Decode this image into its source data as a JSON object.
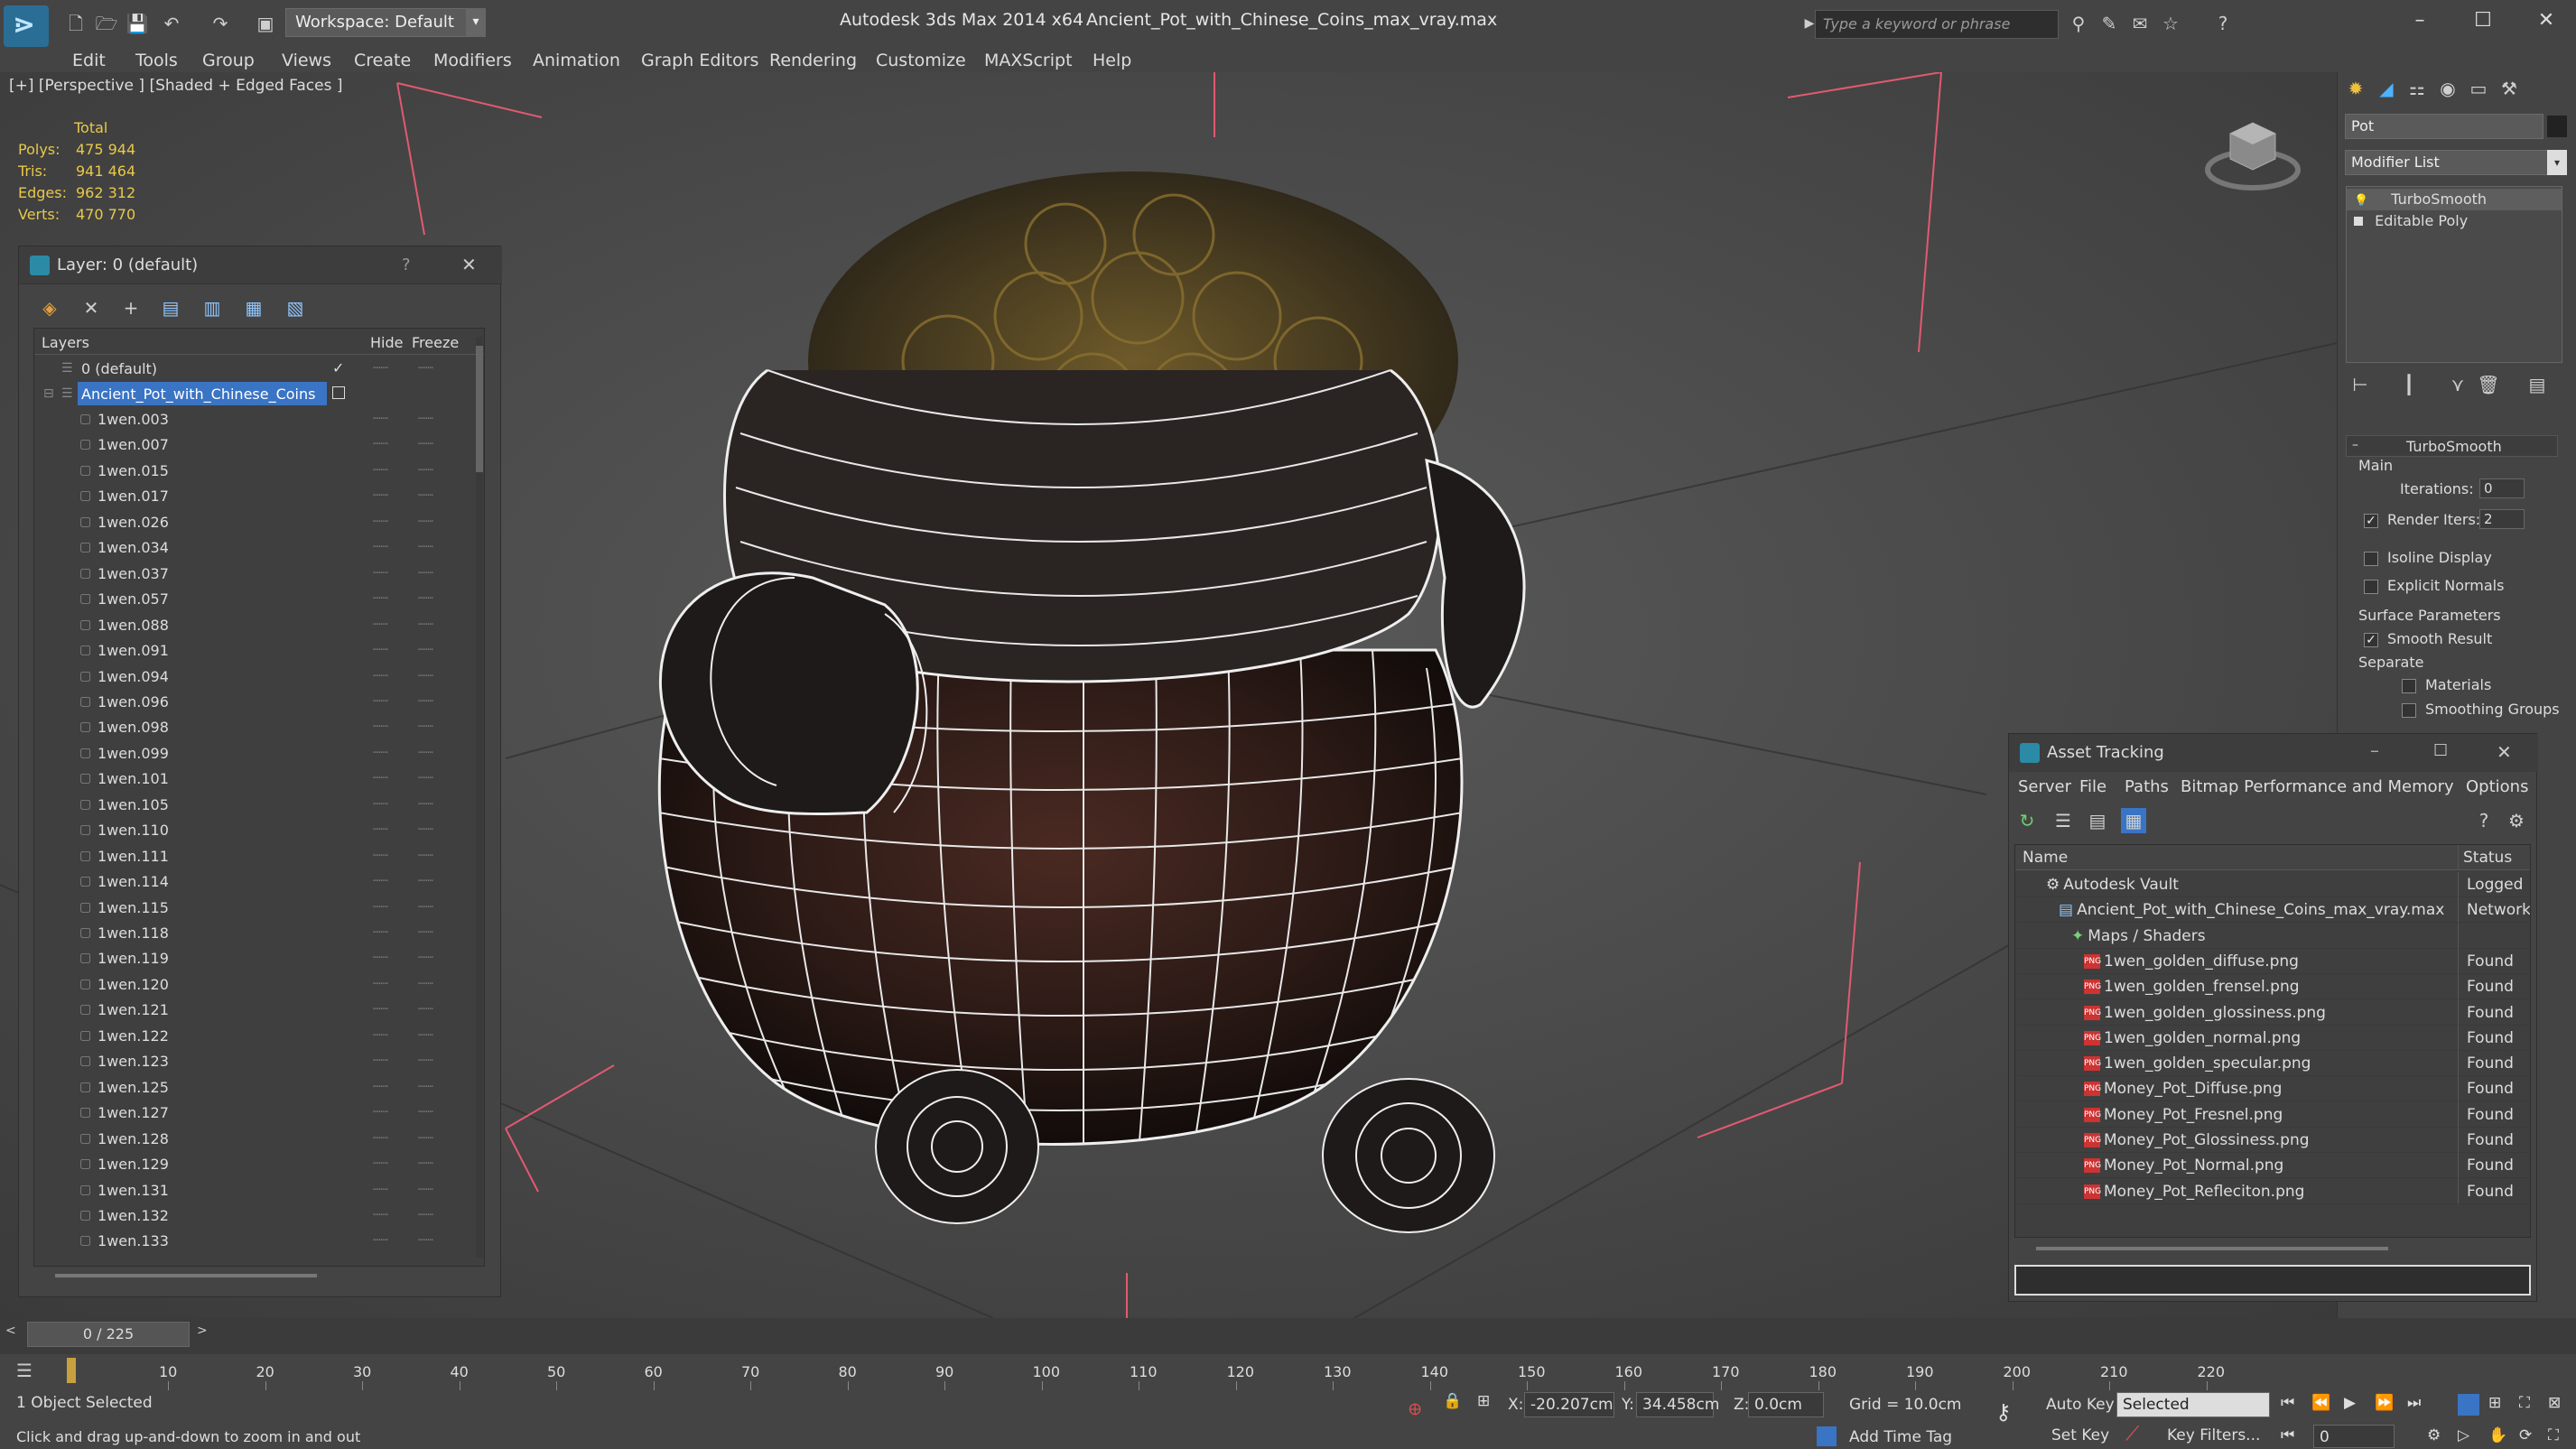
{
  "titlebar": {
    "app_title": "Autodesk 3ds Max  2014 x64",
    "file_title": "Ancient_Pot_with_Chinese_Coins_max_vray.max",
    "workspace": "Workspace: Default",
    "search_placeholder": "Type a keyword or phrase"
  },
  "menubar": {
    "items": [
      "Edit",
      "Tools",
      "Group",
      "Views",
      "Create",
      "Modifiers",
      "Animation",
      "Graph Editors",
      "Rendering",
      "Customize",
      "MAXScript",
      "Help"
    ]
  },
  "viewport": {
    "label": "[+] [Perspective ] [Shaded + Edged Faces ]",
    "stats": {
      "total_label": "Total",
      "rows": [
        {
          "label": "Polys:",
          "value": "475 944"
        },
        {
          "label": "Tris:",
          "value": "941 464"
        },
        {
          "label": "Edges:",
          "value": "962 312"
        },
        {
          "label": "Verts:",
          "value": "470 770"
        }
      ]
    }
  },
  "layer_dialog": {
    "title": "Layer: 0 (default)",
    "help": "?",
    "close": "✕",
    "columns": {
      "layers": "Layers",
      "hide": "Hide",
      "freeze": "Freeze"
    },
    "default_layer": "0 (default)",
    "selected_layer": "Ancient_Pot_with_Chinese_Coins",
    "objects": [
      "1wen.003",
      "1wen.007",
      "1wen.015",
      "1wen.017",
      "1wen.026",
      "1wen.034",
      "1wen.037",
      "1wen.057",
      "1wen.088",
      "1wen.091",
      "1wen.094",
      "1wen.096",
      "1wen.098",
      "1wen.099",
      "1wen.101",
      "1wen.105",
      "1wen.110",
      "1wen.111",
      "1wen.114",
      "1wen.115",
      "1wen.118",
      "1wen.119",
      "1wen.120",
      "1wen.121",
      "1wen.122",
      "1wen.123",
      "1wen.125",
      "1wen.127",
      "1wen.128",
      "1wen.129",
      "1wen.131",
      "1wen.132",
      "1wen.133"
    ]
  },
  "command_panel": {
    "object_name": "Pot",
    "modifier_list": "Modifier List",
    "stack": [
      "TurboSmooth",
      "Editable Poly"
    ],
    "turbosmooth": {
      "title": "TurboSmooth",
      "main": "Main",
      "iterations_label": "Iterations:",
      "iterations_value": "0",
      "render_iters_label": "Render Iters:",
      "render_iters_value": "2",
      "isoline": "Isoline Display",
      "explicit_normals": "Explicit Normals",
      "surface_params": "Surface Parameters",
      "smooth_result": "Smooth Result",
      "separate": "Separate",
      "materials": "Materials",
      "smoothing_groups": "Smoothing Groups"
    }
  },
  "asset_tracking": {
    "title": "Asset Tracking",
    "menu": [
      "Server",
      "File",
      "Paths",
      "Bitmap Performance and Memory",
      "Options"
    ],
    "columns": {
      "name": "Name",
      "status": "Status"
    },
    "rows": [
      {
        "name": "Autodesk Vault",
        "status": "Logged",
        "indent": 1
      },
      {
        "name": "Ancient_Pot_with_Chinese_Coins_max_vray.max",
        "status": "Network",
        "indent": 2
      },
      {
        "name": "Maps / Shaders",
        "status": "",
        "indent": 3
      },
      {
        "name": "1wen_golden_diffuse.png",
        "status": "Found",
        "indent": 4
      },
      {
        "name": "1wen_golden_frensel.png",
        "status": "Found",
        "indent": 4
      },
      {
        "name": "1wen_golden_glossiness.png",
        "status": "Found",
        "indent": 4
      },
      {
        "name": "1wen_golden_normal.png",
        "status": "Found",
        "indent": 4
      },
      {
        "name": "1wen_golden_specular.png",
        "status": "Found",
        "indent": 4
      },
      {
        "name": "Money_Pot_Diffuse.png",
        "status": "Found",
        "indent": 4
      },
      {
        "name": "Money_Pot_Fresnel.png",
        "status": "Found",
        "indent": 4
      },
      {
        "name": "Money_Pot_Glossiness.png",
        "status": "Found",
        "indent": 4
      },
      {
        "name": "Money_Pot_Normal.png",
        "status": "Found",
        "indent": 4
      },
      {
        "name": "Money_Pot_Refleciton.png",
        "status": "Found",
        "indent": 4
      }
    ]
  },
  "timeline": {
    "frame": "0 / 225",
    "ticks": [
      "10",
      "20",
      "30",
      "40",
      "50",
      "60",
      "70",
      "80",
      "90",
      "100",
      "110",
      "120",
      "130",
      "140",
      "150",
      "160",
      "170",
      "180",
      "190",
      "200",
      "210",
      "220"
    ]
  },
  "statusbar": {
    "selected": "1 Object Selected",
    "hint": "Click and drag up-and-down to zoom in and out",
    "x_label": "X:",
    "x_value": "-20.207cm",
    "y_label": "Y:",
    "y_value": "34.458cm",
    "z_label": "Z:",
    "z_value": "0.0cm",
    "grid": "Grid = 10.0cm",
    "add_time_tag": "Add Time Tag",
    "auto_key": "Auto Key",
    "set_key": "Set Key",
    "selected_dd": "Selected",
    "key_filters": "Key Filters...",
    "frame_value": "0"
  }
}
